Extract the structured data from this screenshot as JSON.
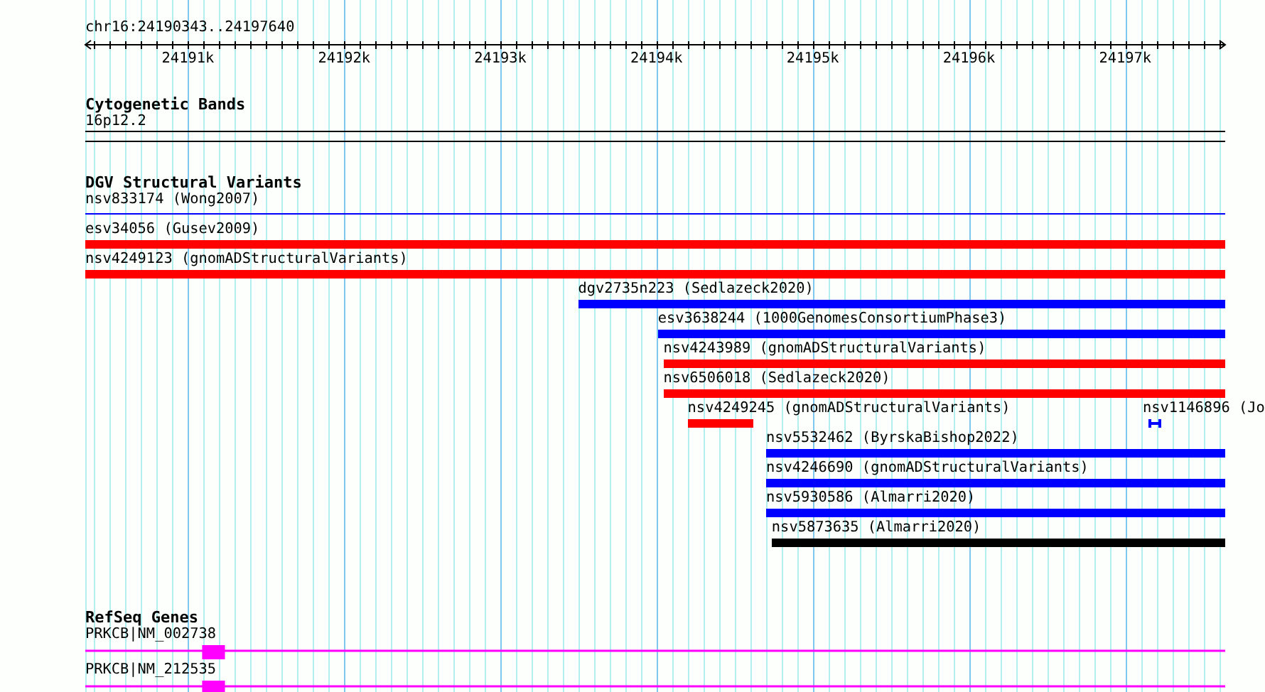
{
  "ruler": {
    "region": "chr16:24190343..24197640",
    "ticks": [
      {
        "label": "24191k"
      },
      {
        "label": "24192k"
      },
      {
        "label": "24193k"
      },
      {
        "label": "24194k"
      },
      {
        "label": "24195k"
      },
      {
        "label": "24196k"
      },
      {
        "label": "24197k"
      }
    ]
  },
  "cytogenetic_bands": {
    "title": "Cytogenetic Bands",
    "bands": [
      {
        "name": "16p12.2"
      }
    ]
  },
  "dgv_structural_variants": {
    "title": "DGV Structural Variants",
    "rows": [
      [
        {
          "label": "nsv833174 (Wong2007)",
          "kind": "line",
          "color": "#0000ff"
        }
      ],
      [
        {
          "label": "esv34056 (Gusev2009)",
          "kind": "bar",
          "color": "#ff0000"
        }
      ],
      [
        {
          "label": "nsv4249123 (gnomADStructuralVariants)",
          "kind": "bar",
          "color": "#ff0000"
        }
      ],
      [
        {
          "label": "dgv2735n223 (Sedlazeck2020)",
          "kind": "bar",
          "color": "#0000ff"
        }
      ],
      [
        {
          "label": "esv3638244 (1000GenomesConsortiumPhase3)",
          "kind": "bar",
          "color": "#0000ff"
        }
      ],
      [
        {
          "label": "nsv4243989 (gnomADStructuralVariants)",
          "kind": "bar",
          "color": "#ff0000"
        }
      ],
      [
        {
          "label": "nsv6506018 (Sedlazeck2020)",
          "kind": "bar",
          "color": "#ff0000"
        }
      ],
      [
        {
          "label": "nsv4249245 (gnomADStructuralVariants)",
          "kind": "bar",
          "color": "#ff0000"
        },
        {
          "label": "nsv1146896 (Jo",
          "kind": "interval",
          "color": "#0000ff"
        }
      ],
      [
        {
          "label": "nsv5532462 (ByrskaBishop2022)",
          "kind": "bar",
          "color": "#0000ff"
        }
      ],
      [
        {
          "label": "nsv4246690 (gnomADStructuralVariants)",
          "kind": "bar",
          "color": "#0000ff"
        }
      ],
      [
        {
          "label": "nsv5930586 (Almarri2020)",
          "kind": "bar",
          "color": "#0000ff"
        }
      ],
      [
        {
          "label": "nsv5873635 (Almarri2020)",
          "kind": "bar",
          "color": "#000000"
        }
      ]
    ]
  },
  "refseq_genes": {
    "title": "RefSeq Genes",
    "transcripts": [
      {
        "label": "PRKCB|NM_002738"
      },
      {
        "label": "PRKCB|NM_212535"
      }
    ]
  }
}
